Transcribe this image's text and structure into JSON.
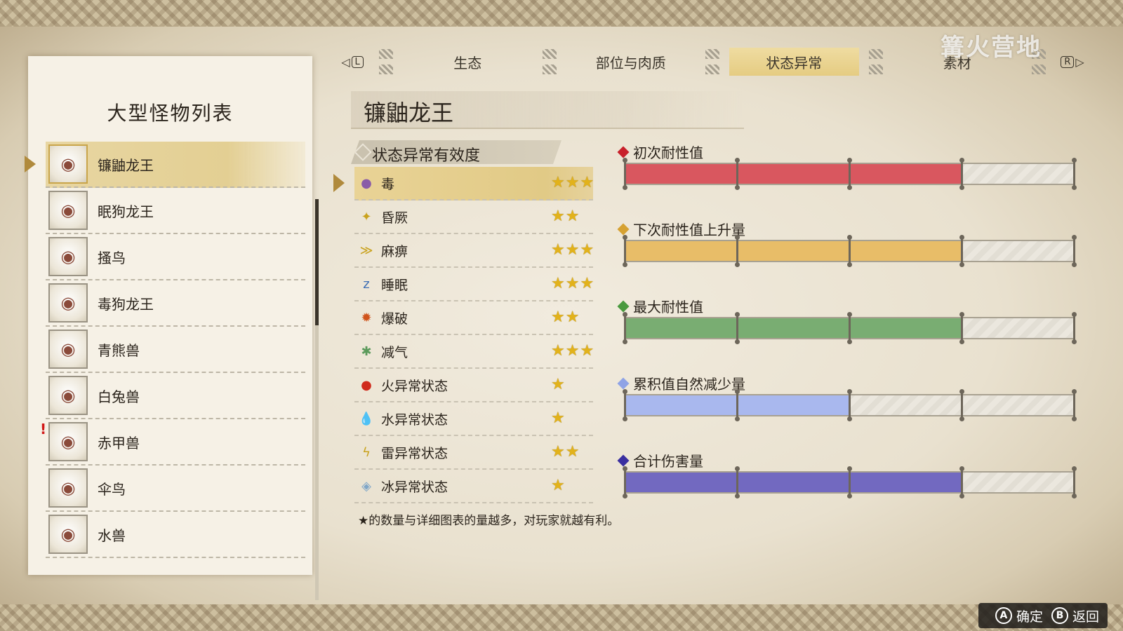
{
  "left_panel": {
    "title": "大型怪物列表",
    "monsters": [
      {
        "name": "镰鼬龙王",
        "icon": "monster-portrait",
        "selected": true
      },
      {
        "name": "眠狗龙王",
        "icon": "monster-portrait"
      },
      {
        "name": "搔鸟",
        "icon": "monster-portrait"
      },
      {
        "name": "毒狗龙王",
        "icon": "monster-portrait"
      },
      {
        "name": "青熊兽",
        "icon": "monster-portrait"
      },
      {
        "name": "白兔兽",
        "icon": "monster-portrait"
      },
      {
        "name": "赤甲兽",
        "icon": "monster-portrait",
        "alert": "!"
      },
      {
        "name": "伞鸟",
        "icon": "monster-portrait"
      },
      {
        "name": "水兽",
        "icon": "monster-portrait"
      }
    ]
  },
  "tabs": {
    "left_key": "L",
    "right_key": "R",
    "items": [
      {
        "label": "生态"
      },
      {
        "label": "部位与肉质"
      },
      {
        "label": "状态异常",
        "active": true
      },
      {
        "label": "素材"
      }
    ]
  },
  "watermark": "篝火营地",
  "monster_title": "镰鼬龙王",
  "effectiveness": {
    "header": "状态异常有效度",
    "rows": [
      {
        "name": "毒",
        "stars": "★★★",
        "icon": "poison-icon",
        "icon_glyph": "●",
        "icon_color": "#8a5ba8",
        "selected": true
      },
      {
        "name": "昏厥",
        "stars": "★★",
        "icon": "stun-icon",
        "icon_glyph": "✦",
        "icon_color": "#c9a21d"
      },
      {
        "name": "麻痹",
        "stars": "★★★",
        "icon": "paralysis-icon",
        "icon_glyph": "≫",
        "icon_color": "#c9a21d"
      },
      {
        "name": "睡眠",
        "stars": "★★★",
        "icon": "sleep-icon",
        "icon_glyph": "z",
        "icon_color": "#3f6fb5"
      },
      {
        "name": "爆破",
        "stars": "★★",
        "icon": "blast-icon",
        "icon_glyph": "✹",
        "icon_color": "#d0531b"
      },
      {
        "name": "减气",
        "stars": "★★★",
        "icon": "exhaust-icon",
        "icon_glyph": "✱",
        "icon_color": "#5b9a5b"
      },
      {
        "name": "火异常状态",
        "stars": "★",
        "icon": "fire-icon",
        "icon_glyph": "●",
        "icon_color": "#d02a1c"
      },
      {
        "name": "水异常状态",
        "stars": "★",
        "icon": "water-icon",
        "icon_glyph": "💧",
        "icon_color": "#3b8fd6"
      },
      {
        "name": "雷异常状态",
        "stars": "★★",
        "icon": "thunder-icon",
        "icon_glyph": "ϟ",
        "icon_color": "#c9a21d"
      },
      {
        "name": "冰异常状态",
        "stars": "★",
        "icon": "ice-icon",
        "icon_glyph": "◈",
        "icon_color": "#7fa6c8"
      }
    ]
  },
  "footnote": "★的数量与详细图表的量越多，对玩家就越有利。",
  "bars": [
    {
      "label": "初次耐性值",
      "segments_filled": 3,
      "segments_total": 4,
      "color": "#d9575f",
      "diamond": "#c8202a"
    },
    {
      "label": "下次耐性值上升量",
      "segments_filled": 3,
      "segments_total": 4,
      "color": "#e8bd68",
      "diamond": "#d6a232"
    },
    {
      "label": "最大耐性值",
      "segments_filled": 3,
      "segments_total": 4,
      "color": "#79ad72",
      "diamond": "#4a9a3f"
    },
    {
      "label": "累积值自然减少量",
      "segments_filled": 2,
      "segments_total": 4,
      "color": "#a9b8ee",
      "diamond": "#8fa3e6"
    },
    {
      "label": "合计伤害量",
      "segments_filled": 3,
      "segments_total": 4,
      "color": "#7269c0",
      "diamond": "#3a2fa0"
    }
  ],
  "prompts": {
    "confirm_button": "A",
    "confirm_label": "确定",
    "back_button": "B",
    "back_label": "返回"
  }
}
